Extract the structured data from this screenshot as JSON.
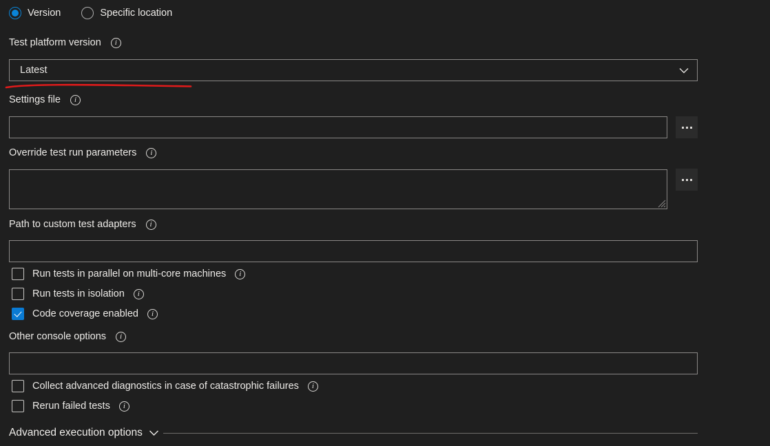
{
  "form": {
    "source_options": {
      "selected": "Version",
      "options": [
        {
          "label": "Version",
          "checked": true
        },
        {
          "label": "Specific location",
          "checked": false
        }
      ]
    },
    "fields": [
      {
        "id": "test-platform-version",
        "label": "Test platform version",
        "type": "dropdown",
        "value": "Latest",
        "info": true
      },
      {
        "id": "settings-file",
        "label": "Settings file",
        "type": "text-with-browse",
        "value": "",
        "info": true
      },
      {
        "id": "override-test-run-parameters",
        "label": "Override test run parameters",
        "type": "textarea-with-browse",
        "value": "",
        "info": true
      },
      {
        "id": "path-to-custom-test-adapters",
        "label": "Path to custom test adapters",
        "type": "text",
        "value": "",
        "info": true
      },
      {
        "id": "other-console-options",
        "label": "Other console options",
        "type": "text",
        "value": "",
        "info": true
      }
    ],
    "checkboxes": [
      {
        "id": "run-tests-in-parallel",
        "label": "Run tests in parallel on multi-core machines",
        "checked": false,
        "info": true
      },
      {
        "id": "run-tests-in-isolation",
        "label": "Run tests in isolation",
        "checked": false,
        "info": true
      },
      {
        "id": "code-coverage-enabled",
        "label": "Code coverage enabled",
        "checked": true,
        "info": true
      },
      {
        "id": "collect-advanced-diagnostics",
        "label": "Collect advanced diagnostics in case of catastrophic failures",
        "checked": false,
        "info": true
      },
      {
        "id": "rerun-failed-tests",
        "label": "Rerun failed tests",
        "checked": false,
        "info": true
      }
    ],
    "advanced_section": {
      "label": "Advanced execution options",
      "expanded": false
    },
    "browse_button_label": "...",
    "icons": {
      "info": "info-icon",
      "chevron_down": "chevron-down-icon",
      "ellipsis": "ellipsis-icon",
      "resize_grip": "resize-grip-icon"
    },
    "colors": {
      "background": "#1f1f1f",
      "accent": "#0a7bd4",
      "border": "#8a8886",
      "text": "#eceae7",
      "annotation": "#e01b1b"
    }
  }
}
